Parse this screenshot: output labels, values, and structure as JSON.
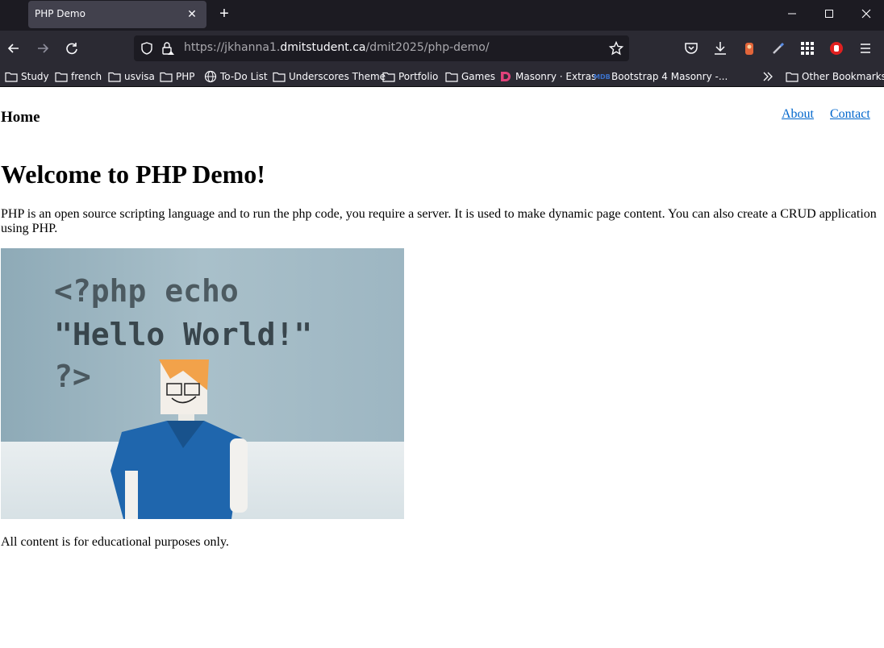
{
  "browser": {
    "tab_title": "PHP Demo",
    "url": {
      "prefix": "https://jkhanna1.",
      "domain": "dmitstudent.ca",
      "path": "/dmit2025/php-demo/"
    },
    "bookmarks": [
      {
        "label": "Study",
        "icon": "folder-icon"
      },
      {
        "label": "french",
        "icon": "folder-icon"
      },
      {
        "label": "usvisa",
        "icon": "folder-icon"
      },
      {
        "label": "PHP",
        "icon": "folder-icon"
      },
      {
        "label": "To-Do List",
        "icon": "globe-icon"
      },
      {
        "label": "Underscores Theme",
        "icon": "folder-icon"
      },
      {
        "label": "Portfolio",
        "icon": "folder-icon"
      },
      {
        "label": "Games",
        "icon": "folder-icon"
      },
      {
        "label": "Masonry · Extras",
        "icon": "masonry-icon"
      },
      {
        "label": "Bootstrap 4 Masonry -...",
        "icon": "mdb-icon"
      }
    ],
    "other_bookmarks": "Other Bookmarks",
    "mdb_badge": "MDB"
  },
  "page": {
    "site_title": "Home",
    "nav": [
      {
        "label": "About"
      },
      {
        "label": "Contact"
      }
    ],
    "heading": "Welcome to PHP Demo!",
    "intro": "PHP is an open source scripting language and to run the php code, you require a server. It is used to make dynamic page content. You can also create a CRUD application using PHP.",
    "hero_image": {
      "code_lines": [
        "<?php echo",
        "\"Hello World!\"",
        "?>"
      ]
    },
    "footer": "All content is for educational purposes only."
  }
}
